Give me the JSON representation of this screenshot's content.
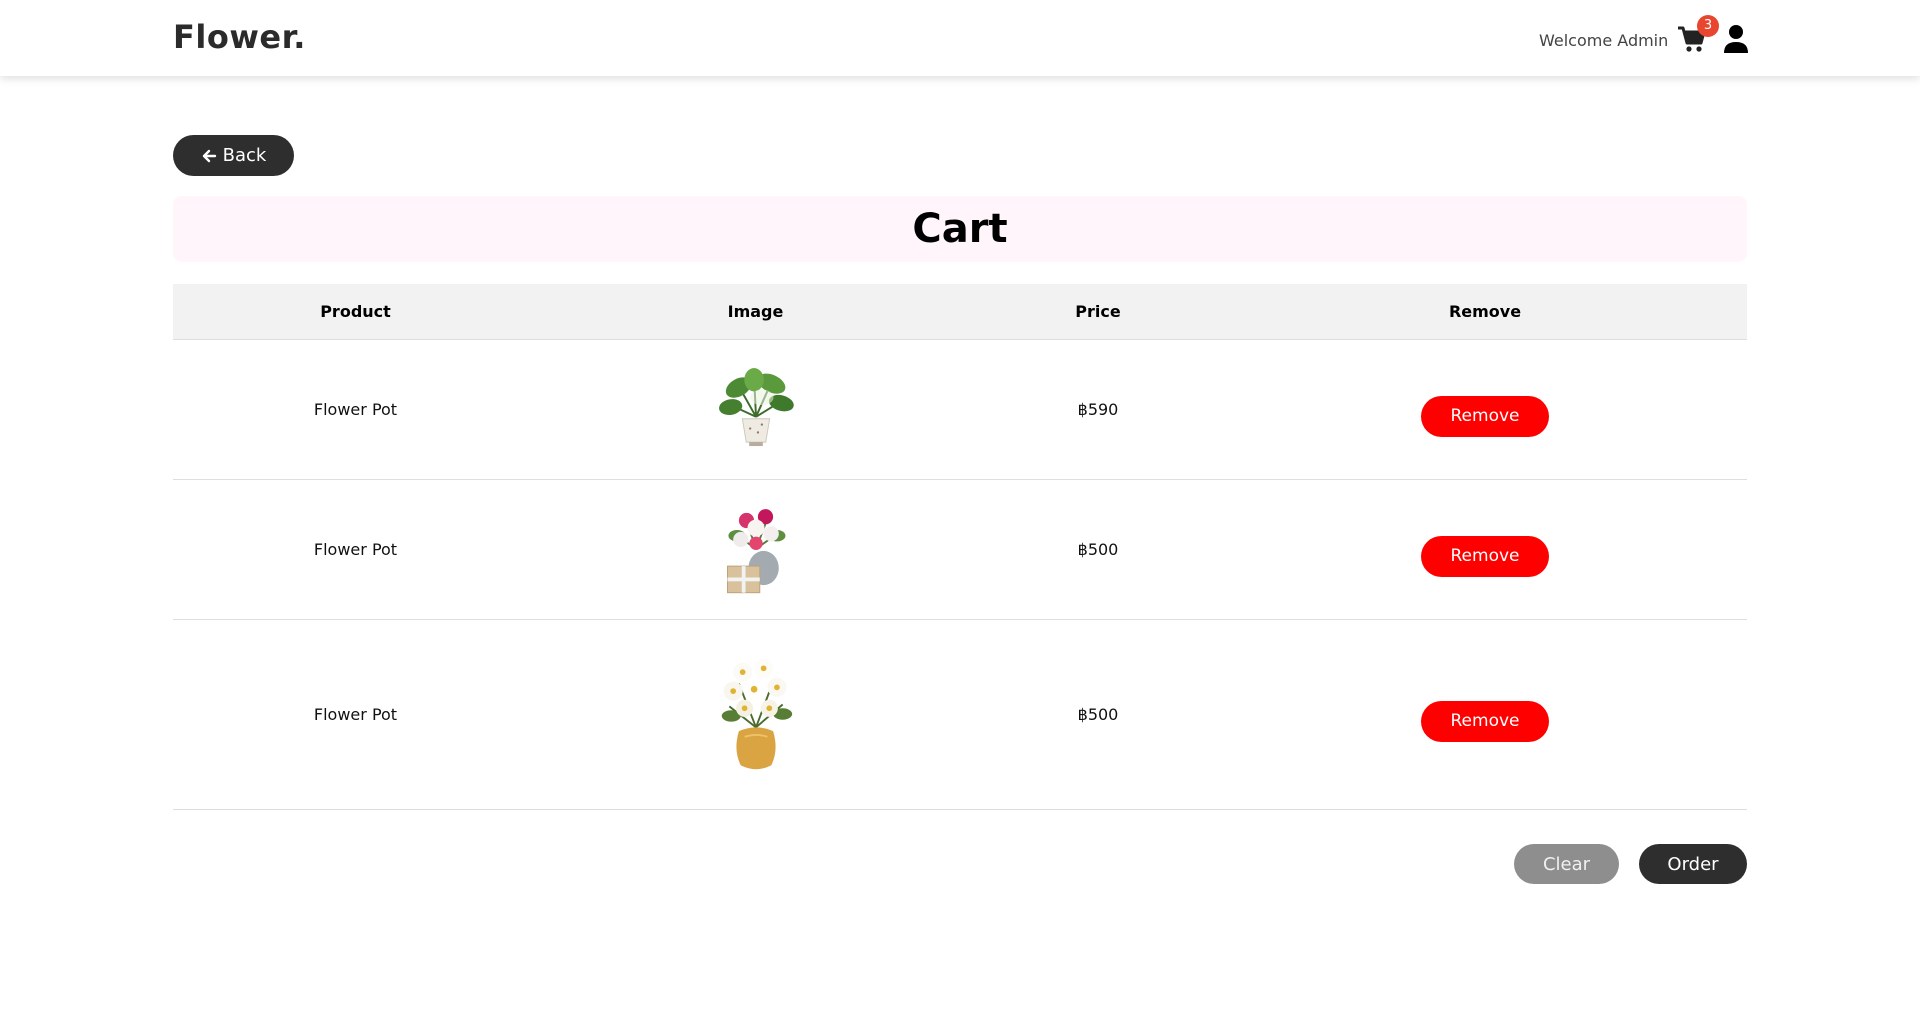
{
  "brand": "Flower.",
  "header": {
    "welcome_text": "Welcome Admin",
    "cart_count": "3",
    "cart_icon": "shopping-cart-icon",
    "user_icon": "user-icon"
  },
  "back_button": {
    "label": "Back",
    "icon": "arrow-left-icon"
  },
  "page_title": "Cart",
  "table": {
    "columns": [
      "Product",
      "Image",
      "Price",
      "Remove"
    ],
    "rows": [
      {
        "product": "Flower Pot",
        "image": "monstera-plant-in-white-pot",
        "price": "฿590",
        "remove_label": "Remove"
      },
      {
        "product": "Flower Pot",
        "image": "pink-roses-in-grey-vase-with-gift-box",
        "price": "฿500",
        "remove_label": "Remove"
      },
      {
        "product": "Flower Pot",
        "image": "white-daisies-in-yellow-vase",
        "price": "฿500",
        "remove_label": "Remove"
      }
    ]
  },
  "actions": {
    "clear_label": "Clear",
    "order_label": "Order"
  },
  "colors": {
    "brand_text": "#2b2b2b",
    "dark_button": "#2e2e2e",
    "remove_button": "#ff0000",
    "clear_button": "#8e8e8e",
    "badge": "#e8462f",
    "title_bg": "#fff5fa",
    "table_header_bg": "#f2f2f2"
  }
}
